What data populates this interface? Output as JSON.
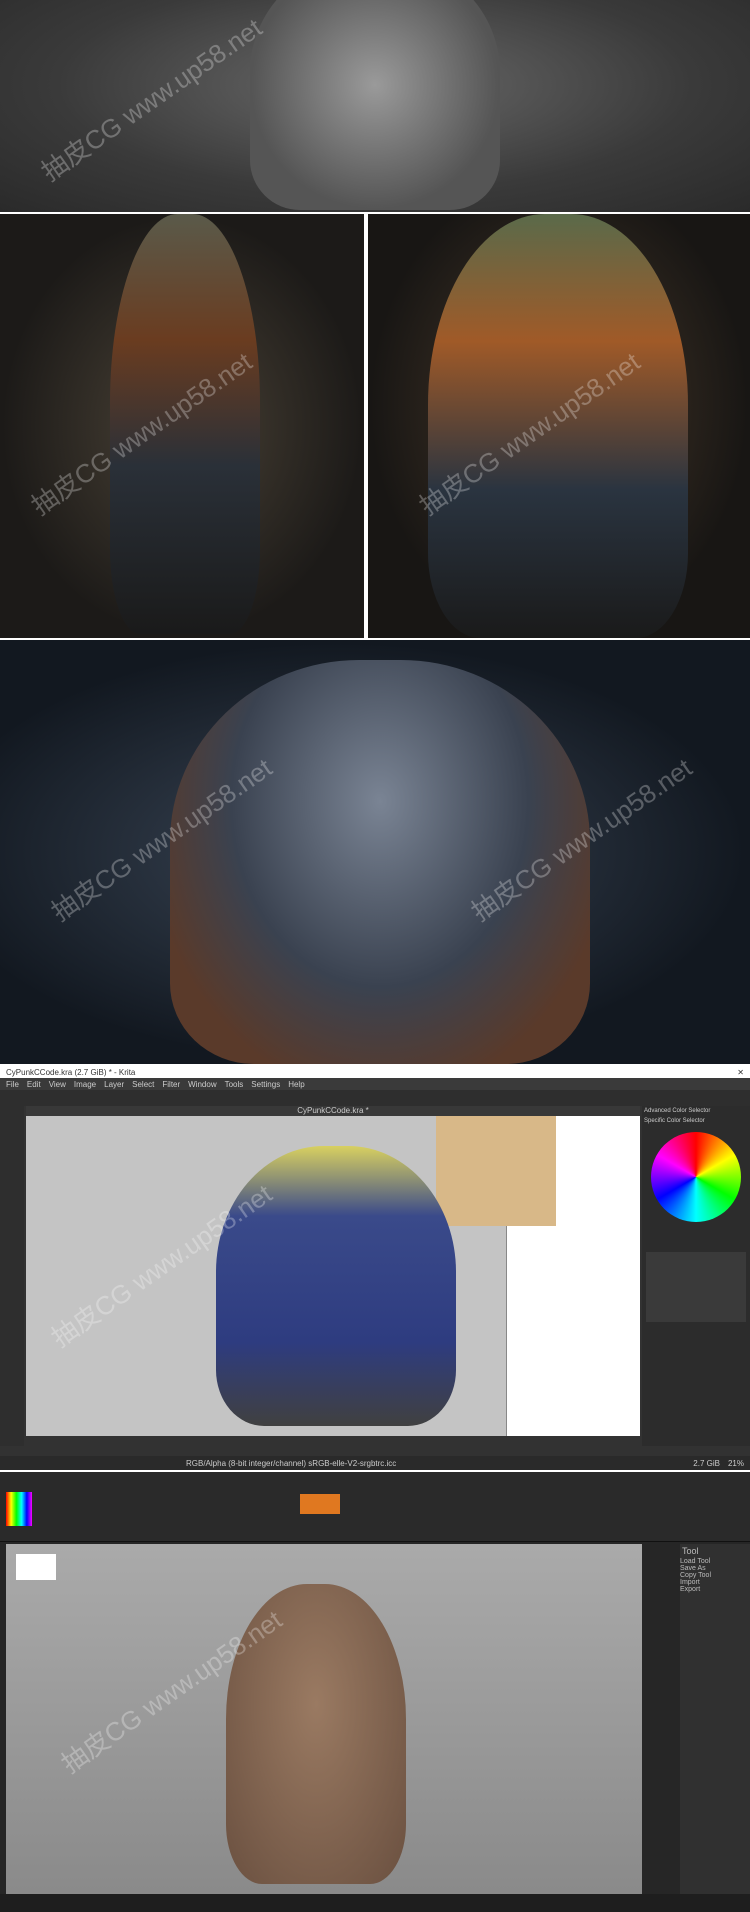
{
  "watermark": "抽皮CG www.up58.net",
  "krita": {
    "title": "CyPunkCCode.kra (2.7 GiB) * - Krita",
    "menu": [
      "File",
      "Edit",
      "View",
      "Image",
      "Layer",
      "Select",
      "Filter",
      "Window",
      "Tools",
      "Settings",
      "Help"
    ],
    "doc_tab": "CyPunkCCode.kra *",
    "dockers": [
      "Advanced Color Selector",
      "Specific Color Selector"
    ],
    "status_profile": "RGB/Alpha (8-bit integer/channel) sRGB-elle-V2-srgbtrc.icc",
    "status_size": "2.7 GiB",
    "zoom": "21%"
  },
  "zbrush": {
    "tool_panel_title": "Tool",
    "buttons": [
      "Load Tool",
      "Save As",
      "Copy Tool",
      "Import",
      "Export"
    ]
  }
}
